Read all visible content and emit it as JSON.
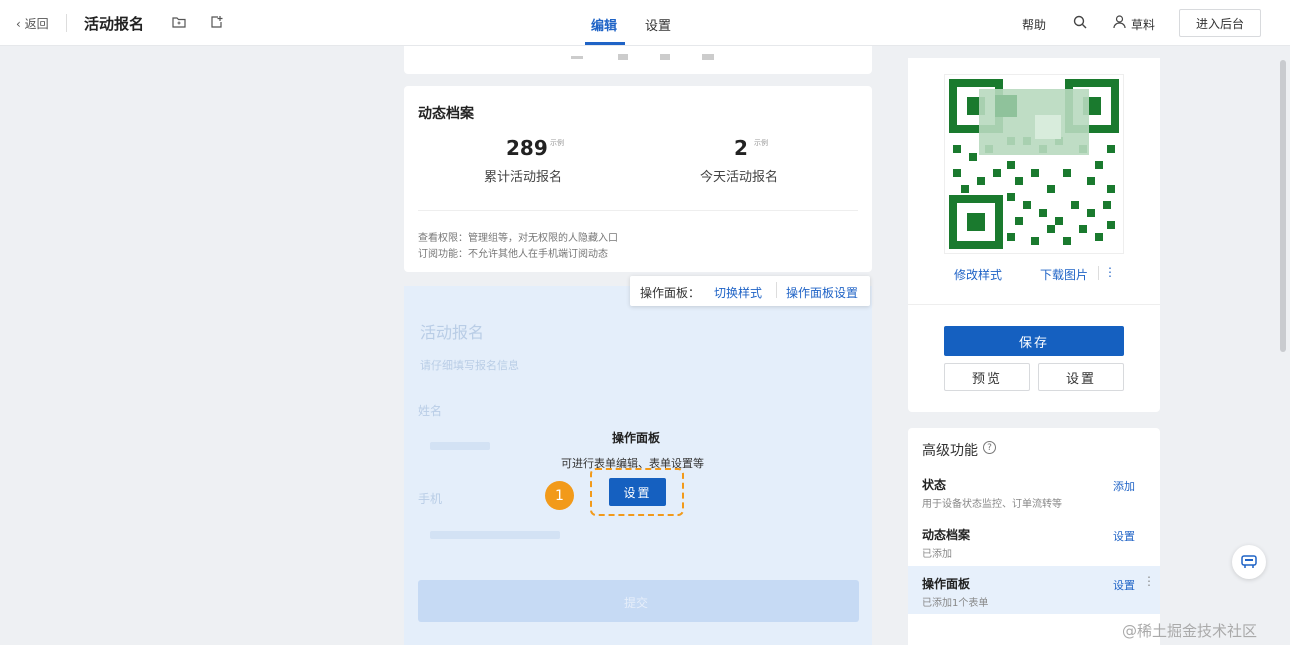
{
  "header": {
    "back_label": "返回",
    "title": "活动报名",
    "tabs": [
      {
        "label": "编辑",
        "active": true
      },
      {
        "label": "设置",
        "active": false
      }
    ],
    "help_label": "帮助",
    "draft_label": "草料",
    "enter_backend_label": "进入后台",
    "icons": [
      "folder-icon",
      "export-icon",
      "search-icon",
      "user-icon"
    ]
  },
  "archive_card": {
    "title": "动态档案",
    "stats": [
      {
        "value": "289",
        "unit": "示例",
        "label": "累计活动报名"
      },
      {
        "value": "2",
        "unit": "示例",
        "label": "今天活动报名"
      }
    ],
    "notes": [
      "查看权限：管理组等，对无权限的人隐藏入口",
      "订阅功能：不允许其他人在手机端订阅动态"
    ]
  },
  "operation_bar": {
    "label": "操作面板：",
    "switch_style": "切换样式",
    "panel_settings": "操作面板设置"
  },
  "form_preview": {
    "title": "活动报名",
    "subtitle": "请仔细填写报名信息",
    "fields": [
      "姓名",
      "手机"
    ],
    "submit_label": "提交"
  },
  "operation_popup": {
    "title": "操作面板",
    "description": "可进行表单编辑、表单设置等",
    "button_label": "设置",
    "step_marker": "1"
  },
  "qr_panel": {
    "modify_style": "修改样式",
    "download_image": "下载图片",
    "save_label": "保存",
    "preview_label": "预览",
    "settings_label": "设置"
  },
  "advanced": {
    "title": "高级功能",
    "items": [
      {
        "title": "状态",
        "desc": "用于设备状态监控、订单流转等",
        "action": "添加"
      },
      {
        "title": "动态档案",
        "desc": "已添加",
        "action": "设置"
      },
      {
        "title": "操作面板",
        "desc": "已添加1个表单",
        "action": "设置"
      }
    ]
  },
  "watermark": "@稀土掘金技术社区",
  "colors": {
    "accent": "#1f63c6",
    "primary_button": "#1560c0",
    "step_orange": "#f29a1a",
    "qr_green": "#1a7a2e"
  }
}
